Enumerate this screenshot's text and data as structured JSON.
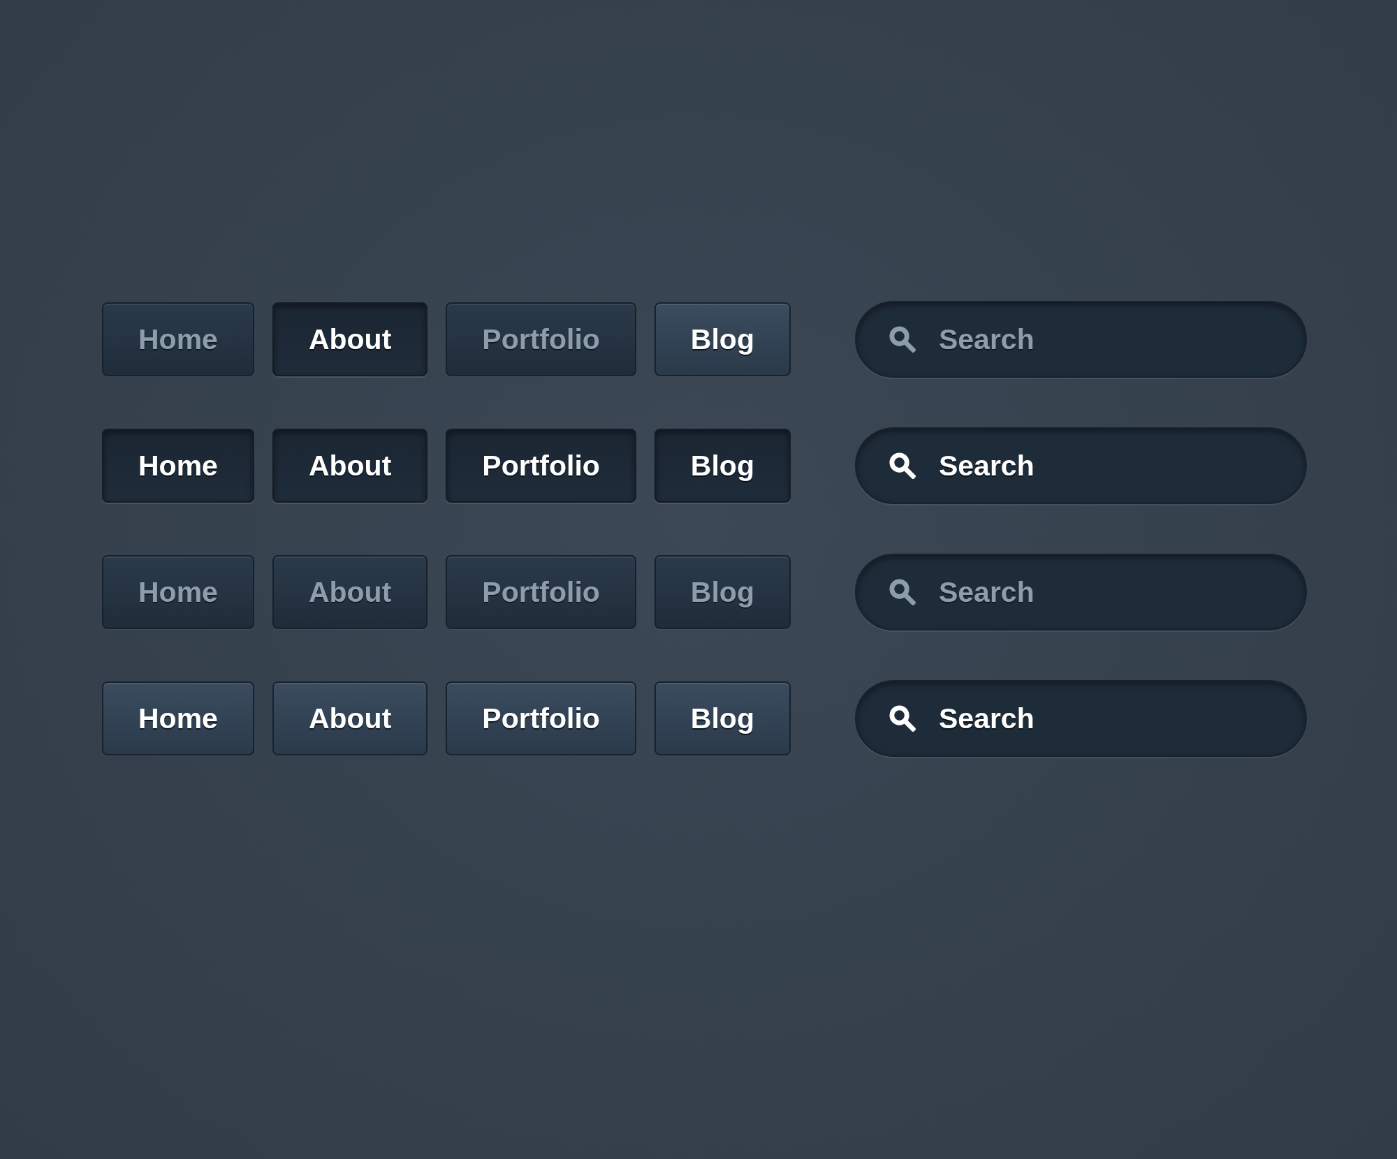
{
  "rows": [
    {
      "buttons": [
        {
          "label": "Home",
          "selected": false,
          "hovered": false
        },
        {
          "label": "About",
          "selected": true,
          "hovered": false
        },
        {
          "label": "Portfolio",
          "selected": false,
          "hovered": false
        },
        {
          "label": "Blog",
          "selected": false,
          "hovered": true
        }
      ],
      "search": {
        "placeholder": "Search",
        "active": false
      }
    },
    {
      "buttons": [
        {
          "label": "Home",
          "selected": true,
          "hovered": false
        },
        {
          "label": "About",
          "selected": true,
          "hovered": false
        },
        {
          "label": "Portfolio",
          "selected": true,
          "hovered": false
        },
        {
          "label": "Blog",
          "selected": true,
          "hovered": false
        }
      ],
      "search": {
        "placeholder": "Search",
        "active": true
      }
    },
    {
      "buttons": [
        {
          "label": "Home",
          "selected": false,
          "hovered": false
        },
        {
          "label": "About",
          "selected": false,
          "hovered": false
        },
        {
          "label": "Portfolio",
          "selected": false,
          "hovered": false
        },
        {
          "label": "Blog",
          "selected": false,
          "hovered": false
        }
      ],
      "search": {
        "placeholder": "Search",
        "active": false
      }
    },
    {
      "buttons": [
        {
          "label": "Home",
          "selected": false,
          "hovered": true
        },
        {
          "label": "About",
          "selected": false,
          "hovered": true
        },
        {
          "label": "Portfolio",
          "selected": false,
          "hovered": true
        },
        {
          "label": "Blog",
          "selected": false,
          "hovered": true
        }
      ],
      "search": {
        "placeholder": "Search",
        "active": true
      }
    }
  ]
}
